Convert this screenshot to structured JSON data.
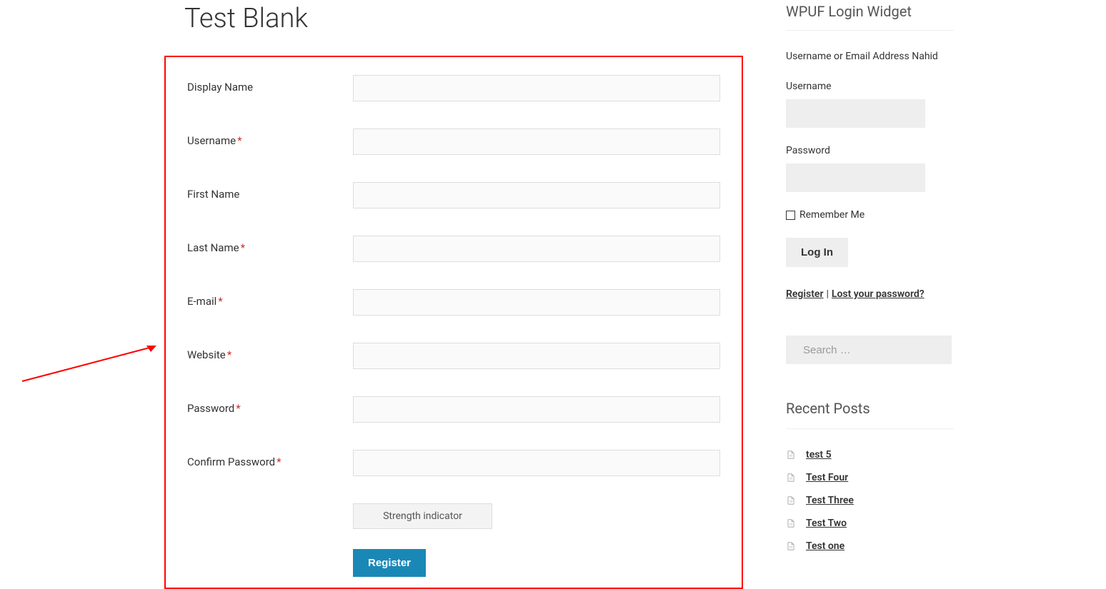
{
  "page": {
    "title": "Test Blank"
  },
  "form": {
    "fields": [
      {
        "label": "Display Name",
        "required": false
      },
      {
        "label": "Username",
        "required": true
      },
      {
        "label": "First Name",
        "required": false
      },
      {
        "label": "Last Name",
        "required": true
      },
      {
        "label": "E-mail",
        "required": true
      },
      {
        "label": "Website",
        "required": true
      },
      {
        "label": "Password",
        "required": true
      },
      {
        "label": "Confirm Password",
        "required": true
      }
    ],
    "strength_label": "Strength indicator",
    "submit_label": "Register"
  },
  "login_widget": {
    "title": "WPUF Login Widget",
    "prompt": "Username or Email Address Nahid",
    "username_label": "Username",
    "password_label": "Password",
    "remember_label": "Remember Me",
    "login_button": "Log In",
    "register_link": "Register",
    "lost_password_link": "Lost your password?"
  },
  "search": {
    "placeholder": "Search …"
  },
  "recent_posts": {
    "title": "Recent Posts",
    "items": [
      "test 5",
      "Test Four",
      "Test Three",
      "Test Two",
      "Test one"
    ]
  },
  "colors": {
    "primary_button": "#1a88b6",
    "required_mark": "#c9302c",
    "annotation": "#ff0000"
  }
}
